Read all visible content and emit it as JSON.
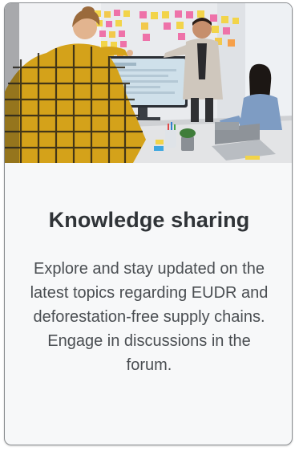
{
  "card": {
    "title": "Knowledge sharing",
    "description": "Explore and stay updated on the latest topics regarding EUDR and deforestation-free supply chains. Engage in discussions in the forum.",
    "image_subject": "team-meeting-photo",
    "colors": {
      "title": "#2f3337",
      "description": "#4a4e52",
      "card_background": "#f7f8f9",
      "border": "#8a8d90"
    }
  }
}
